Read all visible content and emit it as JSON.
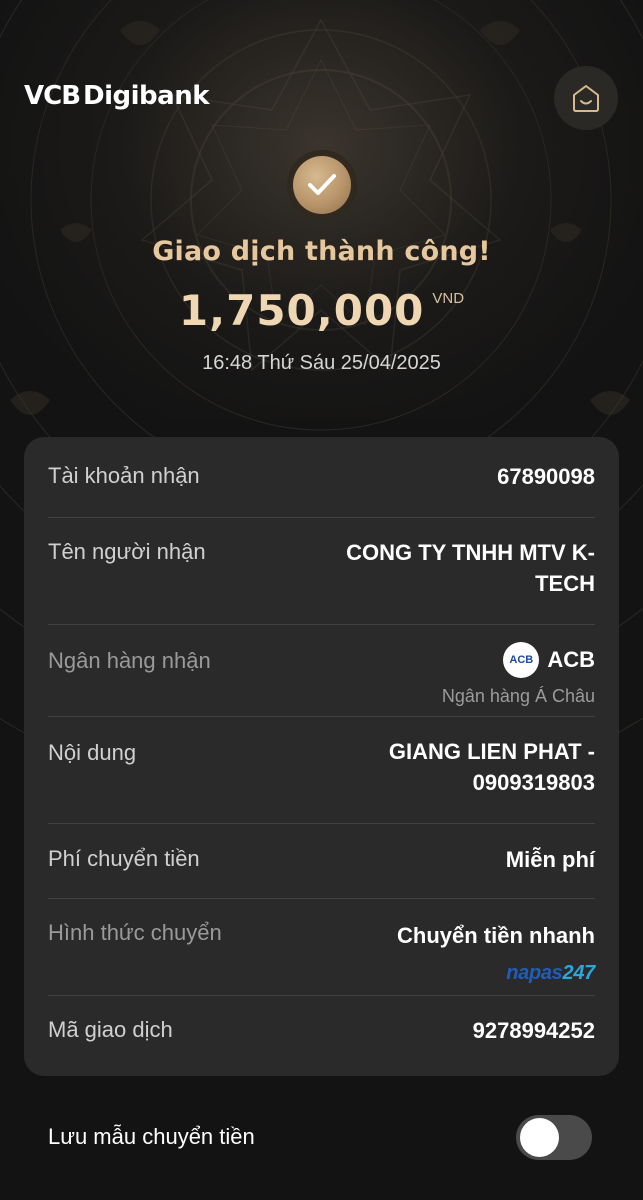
{
  "header": {
    "brand_vcb": "VCB",
    "brand_digibank": "Digibank",
    "home_icon": "home-icon"
  },
  "result": {
    "status_icon": "check-icon",
    "status_text": "Giao dịch thành công!",
    "amount": "1,750,000",
    "currency": "VND",
    "datetime": "16:48 Thứ Sáu 25/04/2025"
  },
  "details": {
    "account_label": "Tài khoản nhận",
    "account_value": "67890098",
    "recipient_label": "Tên người nhận",
    "recipient_line1": "CONG TY TNHH MTV K-",
    "recipient_line2": "TECH",
    "bank_label": "Ngân hàng nhận",
    "bank_logo_text": "ACB",
    "bank_short": "ACB",
    "bank_full": "Ngân hàng Á Châu",
    "content_label": "Nội dung",
    "content_line1": "GIANG LIEN PHAT -",
    "content_line2": "0909319803",
    "fee_label": "Phí chuyển tiền",
    "fee_value": "Miễn phí",
    "method_label": "Hình thức chuyển",
    "method_value": "Chuyển tiền nhanh",
    "network_logo_part1": "napas",
    "network_logo_part2": "247",
    "txn_label": "Mã giao dịch",
    "txn_value": "9278994252"
  },
  "save_template": {
    "label": "Lưu mẫu chuyển tiền",
    "enabled": false
  },
  "colors": {
    "background": "#131313",
    "card": "#2a2a2a",
    "accent_gold": "#e7c79e",
    "napas_blue": "#1f5dbb",
    "napas_cyan": "#2aa7df"
  }
}
